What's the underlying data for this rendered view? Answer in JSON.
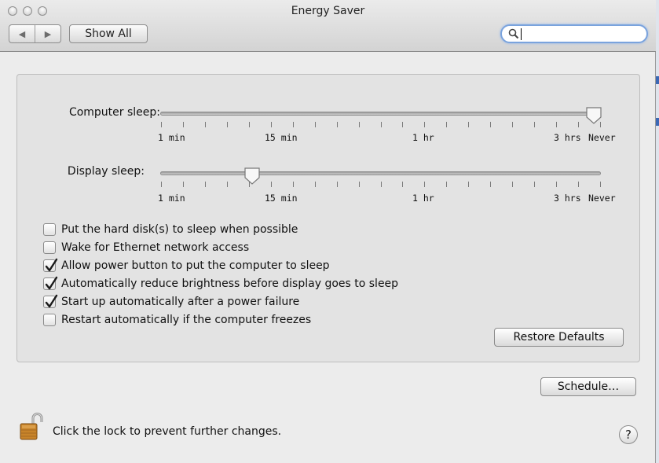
{
  "window": {
    "title": "Energy Saver"
  },
  "toolbar": {
    "back_icon": "back-arrow-icon",
    "forward_icon": "forward-arrow-icon",
    "show_all_label": "Show All",
    "search": {
      "value": "",
      "placeholder": "",
      "icon": "magnifier-icon"
    }
  },
  "sliders": {
    "computer_sleep": {
      "label": "Computer sleep:",
      "scale_labels": [
        "1 min",
        "15 min",
        "1 hr",
        "3 hrs",
        "Never"
      ],
      "value": "Never"
    },
    "display_sleep": {
      "label": "Display sleep:",
      "scale_labels": [
        "1 min",
        "15 min",
        "1 hr",
        "3 hrs",
        "Never"
      ],
      "value": "10 min"
    }
  },
  "options": [
    {
      "label": "Put the hard disk(s) to sleep when possible",
      "checked": false
    },
    {
      "label": "Wake for Ethernet network access",
      "checked": false
    },
    {
      "label": "Allow power button to put the computer to sleep",
      "checked": true
    },
    {
      "label": "Automatically reduce brightness before display goes to sleep",
      "checked": true
    },
    {
      "label": "Start up automatically after a power failure",
      "checked": true
    },
    {
      "label": "Restart automatically if the computer freezes",
      "checked": false
    }
  ],
  "buttons": {
    "restore_defaults": "Restore Defaults",
    "schedule": "Schedule…",
    "help": "?"
  },
  "footer": {
    "lock_icon": "unlocked-padlock-icon",
    "lock_text": "Click the lock to prevent further changes."
  },
  "colors": {
    "window_bg": "#ececec",
    "group_bg": "#e3e3e3",
    "search_focus": "#7aa3dd",
    "checkmark": "#1a1a1a"
  }
}
